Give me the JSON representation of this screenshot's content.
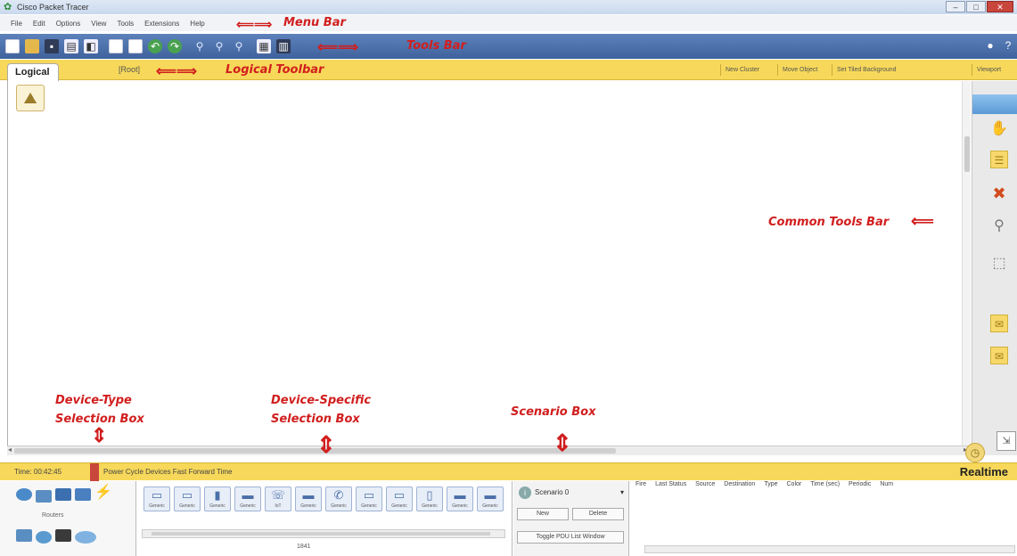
{
  "window": {
    "title": "Cisco Packet Tracer"
  },
  "menu": [
    "File",
    "Edit",
    "Options",
    "View",
    "Tools",
    "Extensions",
    "Help"
  ],
  "logical_toolbar": {
    "tab": "Logical",
    "root": "[Root]",
    "buttons": [
      "New Cluster",
      "Move Object",
      "Set Tiled Background",
      "Viewport"
    ]
  },
  "status": {
    "time": "Time: 00:42:45",
    "power_cycle": "Power Cycle Devices  Fast Forward Time",
    "mode": "Realtime"
  },
  "device_type": {
    "label": "Routers"
  },
  "device_specific": {
    "devices": [
      "Generic",
      "Generic",
      "Generic",
      "Generic",
      "IoT",
      "Generic",
      "Generic",
      "Generic",
      "Generic",
      "Generic",
      "Generic",
      "Generic"
    ],
    "model": "1841"
  },
  "scenario": {
    "name": "Scenario 0",
    "new": "New",
    "delete": "Delete",
    "toggle": "Toggle PDU List Window"
  },
  "events": {
    "columns": [
      "Fire",
      "Last Status",
      "Source",
      "Destination",
      "Type",
      "Color",
      "Time (sec)",
      "Periodic",
      "Num"
    ]
  },
  "annotations": {
    "menu_bar": "Menu Bar",
    "tools_bar": "Tools Bar",
    "logical_toolbar": "Logical Toolbar",
    "common_tools_bar": "Common Tools Bar",
    "device_type_line1": "Device-Type",
    "device_type_line2": "Selection Box",
    "device_specific_line1": "Device-Specific",
    "device_specific_line2": "Selection Box",
    "scenario_box": "Scenario Box"
  },
  "icons": {
    "app": "packet-tracer-icon",
    "toolbar": [
      "new-file-icon",
      "open-folder-icon",
      "save-icon",
      "print-icon",
      "activity-wizard-icon",
      "copy-icon",
      "paste-icon",
      "undo-icon",
      "redo-icon",
      "zoom-in-icon",
      "zoom-reset-icon",
      "zoom-out-icon",
      "palette-icon",
      "custom-device-icon"
    ],
    "common": [
      "select-tool",
      "hand-icon",
      "note-icon",
      "delete-icon",
      "inspect-icon",
      "resize-icon",
      "simple-pdu-icon",
      "complex-pdu-icon"
    ]
  },
  "colors": {
    "annotation": "#d11e1e",
    "yellow_bar": "#f7d85a",
    "tools_bar": "#4a6ea8"
  }
}
